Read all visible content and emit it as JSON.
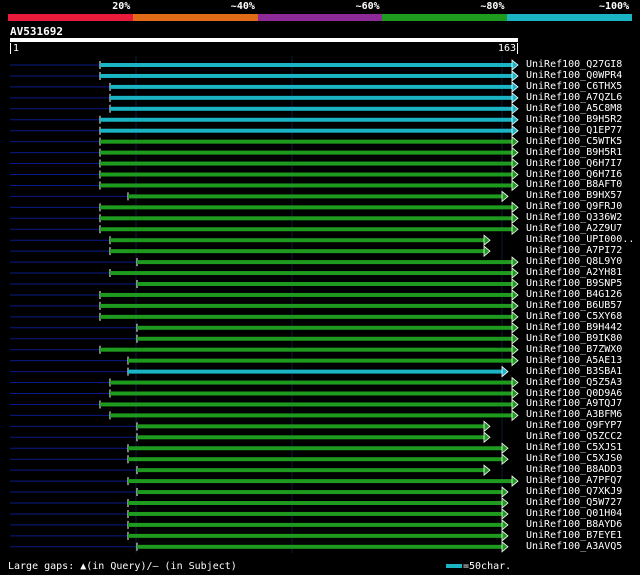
{
  "legend": {
    "segments": [
      {
        "label": "20%",
        "color": "#e81c3a"
      },
      {
        "label": "~40%",
        "color": "#e06a18"
      },
      {
        "label": "~60%",
        "color": "#8e2a98"
      },
      {
        "label": "~80%",
        "color": "#1e9a1e"
      },
      {
        "label": "~100%",
        "color": "#1ab4c4"
      }
    ]
  },
  "query": {
    "name": "AV531692",
    "ruler_start": "1",
    "ruler_end": "163"
  },
  "colors": {
    "cyan": "#1ab4c4",
    "green": "#1e9a1e",
    "line": "#0a1a8a"
  },
  "hits": [
    {
      "label": "UniRef100_Q27GI8",
      "color": "cyan"
    },
    {
      "label": "UniRef100_Q0WPR4",
      "color": "cyan"
    },
    {
      "label": "UniRef100_C6THX5",
      "color": "cyan"
    },
    {
      "label": "UniRef100_A7QZL6",
      "color": "cyan"
    },
    {
      "label": "UniRef100_A5C8M8",
      "color": "cyan"
    },
    {
      "label": "UniRef100_B9H5R2",
      "color": "cyan"
    },
    {
      "label": "UniRef100_Q1EP77",
      "color": "cyan"
    },
    {
      "label": "UniRef100_C5WTK5",
      "color": "green"
    },
    {
      "label": "UniRef100_B9H5R1",
      "color": "green"
    },
    {
      "label": "UniRef100_Q6H7I7",
      "color": "green"
    },
    {
      "label": "UniRef100_Q6H7I6",
      "color": "green"
    },
    {
      "label": "UniRef100_B8AFT0",
      "color": "green"
    },
    {
      "label": "UniRef100_B9HX57",
      "color": "green"
    },
    {
      "label": "UniRef100_Q9FRJ0",
      "color": "green"
    },
    {
      "label": "UniRef100_Q336W2",
      "color": "green"
    },
    {
      "label": "UniRef100_A2Z9U7",
      "color": "green"
    },
    {
      "label": "UniRef100_UPI000..",
      "color": "green"
    },
    {
      "label": "UniRef100_A7PI72",
      "color": "green"
    },
    {
      "label": "UniRef100_Q8L9Y0",
      "color": "green"
    },
    {
      "label": "UniRef100_A2YH81",
      "color": "green"
    },
    {
      "label": "UniRef100_B9SNP5",
      "color": "green"
    },
    {
      "label": "UniRef100_B4G126",
      "color": "green"
    },
    {
      "label": "UniRef100_B6UB57",
      "color": "green"
    },
    {
      "label": "UniRef100_C5XY68",
      "color": "green"
    },
    {
      "label": "UniRef100_B9H442",
      "color": "green"
    },
    {
      "label": "UniRef100_B9IK80",
      "color": "green"
    },
    {
      "label": "UniRef100_B7ZWX0",
      "color": "green"
    },
    {
      "label": "UniRef100_A5AE13",
      "color": "green"
    },
    {
      "label": "UniRef100_B3SBA1",
      "color": "cyan"
    },
    {
      "label": "UniRef100_Q5Z5A3",
      "color": "green"
    },
    {
      "label": "UniRef100_Q0D9A6",
      "color": "green"
    },
    {
      "label": "UniRef100_A9TQJ7",
      "color": "green"
    },
    {
      "label": "UniRef100_A3BFM6",
      "color": "green"
    },
    {
      "label": "UniRef100_Q9FYP7",
      "color": "green"
    },
    {
      "label": "UniRef100_Q5ZCC2",
      "color": "green"
    },
    {
      "label": "UniRef100_C5XJS1",
      "color": "green"
    },
    {
      "label": "UniRef100_C5XJS0",
      "color": "green"
    },
    {
      "label": "UniRef100_B8ADD3",
      "color": "green"
    },
    {
      "label": "UniRef100_A7PFQ7",
      "color": "green"
    },
    {
      "label": "UniRef100_Q7XKJ9",
      "color": "green"
    },
    {
      "label": "UniRef100_Q5W727",
      "color": "green"
    },
    {
      "label": "UniRef100_Q01H04",
      "color": "green"
    },
    {
      "label": "UniRef100_B8AYD6",
      "color": "green"
    },
    {
      "label": "UniRef100_B7EYE1",
      "color": "green"
    },
    {
      "label": "UniRef100_A3AVQ5",
      "color": "green"
    }
  ],
  "footer": {
    "large_gaps": "Large gaps: ▲(in Query)/– (in Subject)",
    "scale": "=50char."
  }
}
